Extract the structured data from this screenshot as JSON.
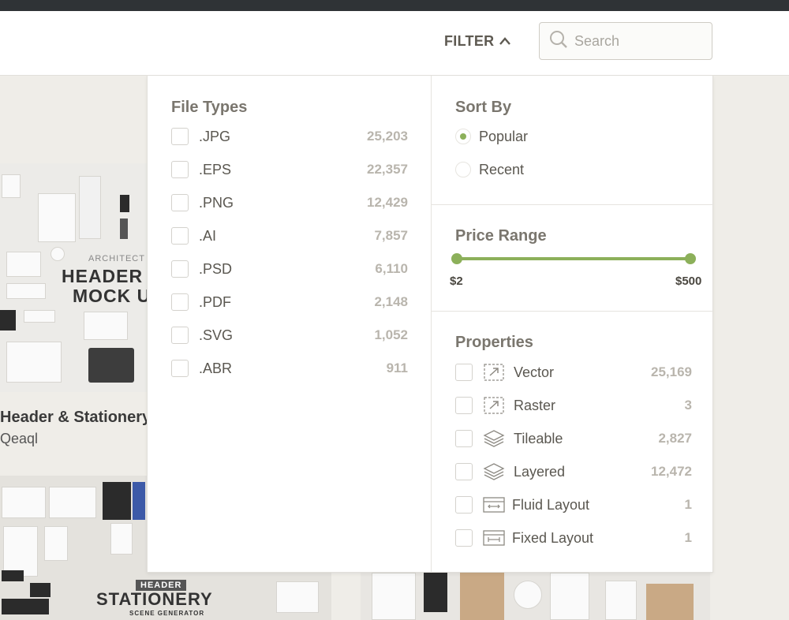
{
  "header": {
    "filter_label": "FILTER",
    "search_placeholder": "Search"
  },
  "background": {
    "card_title": "Header & Stationery",
    "card_author": "Qeaql",
    "image1_small": "ARCHITECT A",
    "image1_line1": "HEADER &",
    "image1_line2": "MOCK U",
    "image2_badge": "HEADER",
    "image2_title": "STATIONERY",
    "image2_sub": "SCENE GENERATOR"
  },
  "file_types": {
    "title": "File Types",
    "items": [
      {
        "label": ".JPG",
        "count": "25,203"
      },
      {
        "label": ".EPS",
        "count": "22,357"
      },
      {
        "label": ".PNG",
        "count": "12,429"
      },
      {
        "label": ".AI",
        "count": "7,857"
      },
      {
        "label": ".PSD",
        "count": "6,110"
      },
      {
        "label": ".PDF",
        "count": "2,148"
      },
      {
        "label": ".SVG",
        "count": "1,052"
      },
      {
        "label": ".ABR",
        "count": "911"
      }
    ]
  },
  "sort_by": {
    "title": "Sort By",
    "options": [
      {
        "label": "Popular",
        "selected": true
      },
      {
        "label": "Recent",
        "selected": false
      }
    ]
  },
  "price_range": {
    "title": "Price Range",
    "min_label": "$2",
    "max_label": "$500"
  },
  "properties": {
    "title": "Properties",
    "items": [
      {
        "label": "Vector",
        "count": "25,169",
        "icon": "vector-icon"
      },
      {
        "label": "Raster",
        "count": "3",
        "icon": "raster-icon"
      },
      {
        "label": "Tileable",
        "count": "2,827",
        "icon": "layers-icon"
      },
      {
        "label": "Layered",
        "count": "12,472",
        "icon": "layers-icon"
      },
      {
        "label": "Fluid Layout",
        "count": "1",
        "icon": "fluid-layout-icon"
      },
      {
        "label": "Fixed Layout",
        "count": "1",
        "icon": "fixed-layout-icon"
      }
    ]
  },
  "colors": {
    "accent": "#8cb05a",
    "topbar": "#2f3336"
  }
}
